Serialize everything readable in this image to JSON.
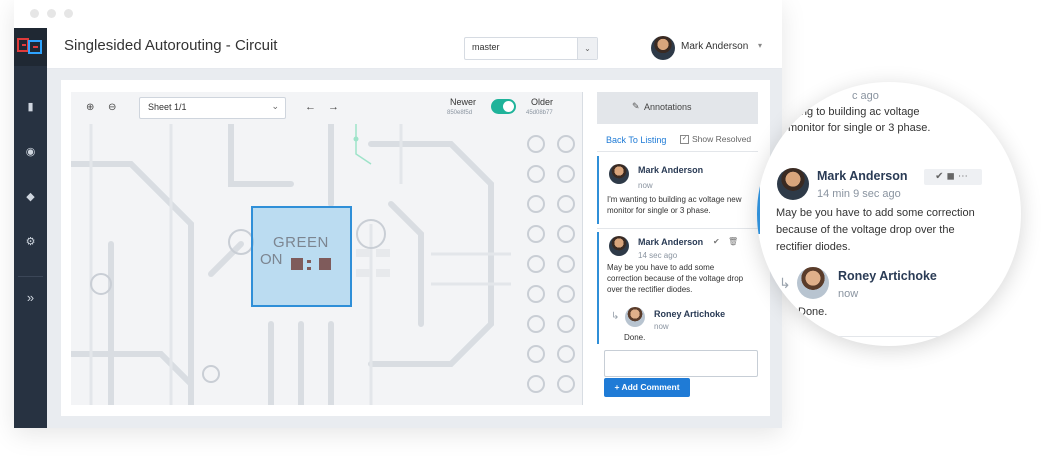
{
  "app": {
    "title": "Singlesided Autorouting - Circuit",
    "branch": "master",
    "user": "Mark Anderson",
    "nav_icons": [
      "file-icon",
      "comments-icon",
      "layers-icon",
      "settings-icon",
      "expand-icon"
    ]
  },
  "toolbar": {
    "sheet": "Sheet  1/1",
    "newer_label": "Newer",
    "newer_hash": "850e8f5d",
    "older_label": "Older",
    "older_hash": "45d08b77"
  },
  "canvas": {
    "highlight_line1": "GREEN",
    "highlight_line2": "ON"
  },
  "annotations": {
    "title": "Annotations",
    "back_link": "Back To Listing",
    "show_resolved": "Show Resolved",
    "comment_placeholder": "",
    "add_button": "+ Add Comment",
    "items": [
      {
        "author": "Mark Anderson",
        "time": "now",
        "text": "I'm wanting to building ac voltage new monitor for single or 3 phase."
      },
      {
        "author": "Mark Anderson",
        "time": "14 sec ago",
        "text": "May be you have to add some correction because of the voltage drop over the rectifier diodes.",
        "reply": {
          "author": "Roney Artichoke",
          "time": "now",
          "text": "Done."
        }
      }
    ]
  },
  "magnifier": {
    "top_fragment_1": "...anting to building ac voltage",
    "top_fragment_2": "monitor for single or 3 phase.",
    "top_time_fragment": "c ago",
    "author": "Mark Anderson",
    "time": "14 min 9 sec ago",
    "text": "May be you have to add some correction because of the voltage drop over the rectifier diodes.",
    "reply_author": "Roney Artichoke",
    "reply_time": "now",
    "reply_text": "Done."
  }
}
